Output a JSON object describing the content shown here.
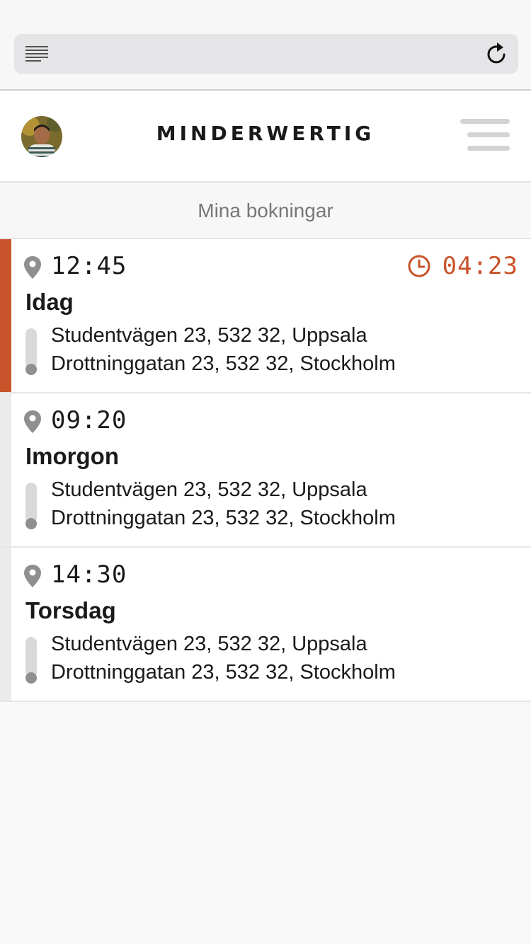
{
  "browser": {
    "reader_icon": "reader-icon",
    "reload_icon": "reload-icon"
  },
  "header": {
    "brand": "MINDERWERTIG",
    "avatar": "avatar",
    "menu_icon": "hamburger-icon"
  },
  "section": {
    "title": "Mina bokningar"
  },
  "colors": {
    "accent": "#c9532a",
    "muted": "#8f8f8f"
  },
  "bookings": [
    {
      "time": "12:45",
      "day": "Idag",
      "countdown": "04:23",
      "from": "Studentvägen 23, 532 32, Uppsala",
      "to": "Drottninggatan 23, 532 32, Stockholm",
      "active": true
    },
    {
      "time": "09:20",
      "day": "Imorgon",
      "from": "Studentvägen 23, 532 32, Uppsala",
      "to": "Drottninggatan 23, 532 32, Stockholm",
      "active": false
    },
    {
      "time": "14:30",
      "day": "Torsdag",
      "from": "Studentvägen 23, 532 32, Uppsala",
      "to": "Drottninggatan 23, 532 32, Stockholm",
      "active": false
    }
  ]
}
